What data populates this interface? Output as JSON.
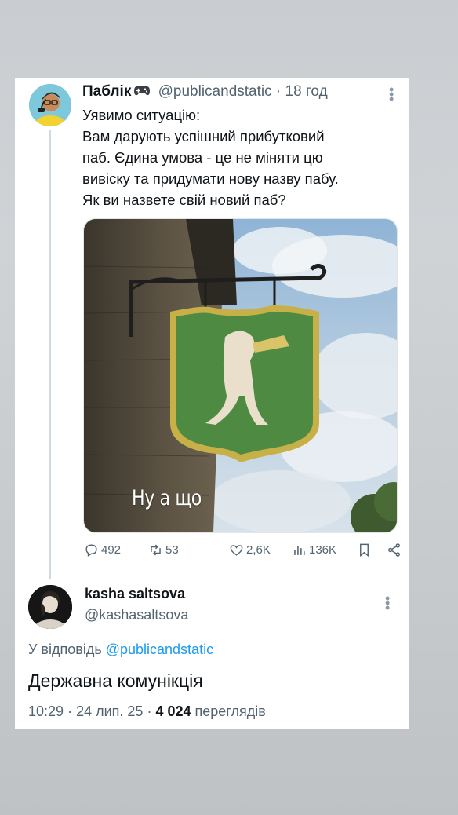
{
  "tweet": {
    "author_name": "Паблік",
    "author_icon": "gamepad-icon",
    "handle": "@publicandstatic",
    "separator": "·",
    "time": "18 год",
    "text_lines": [
      "Уявимо ситуацію:",
      "Вам дарують успішний прибутковий",
      "паб. Єдина умова - це не міняти цю",
      "вивіску та придумати нову назву пабу.",
      "Як ви назвете свій новий паб?"
    ],
    "media_caption": "Ну а що",
    "stats": {
      "replies": "492",
      "reposts": "53",
      "likes": "2,6K",
      "views": "136K"
    }
  },
  "reply": {
    "author_name": "kasha saltsova",
    "handle": "@kashasaltsova",
    "reply_to_prefix": "У відповідь",
    "reply_to_handle": "@publicandstatic",
    "text": "Державна комунікція",
    "time": "10:29",
    "date": "24 лип. 25",
    "views_count": "4 024",
    "views_label": "переглядів"
  },
  "colors": {
    "link": "#1d9bf0",
    "text": "#0f1419",
    "muted": "#536471",
    "background": "#c9cdd1"
  }
}
